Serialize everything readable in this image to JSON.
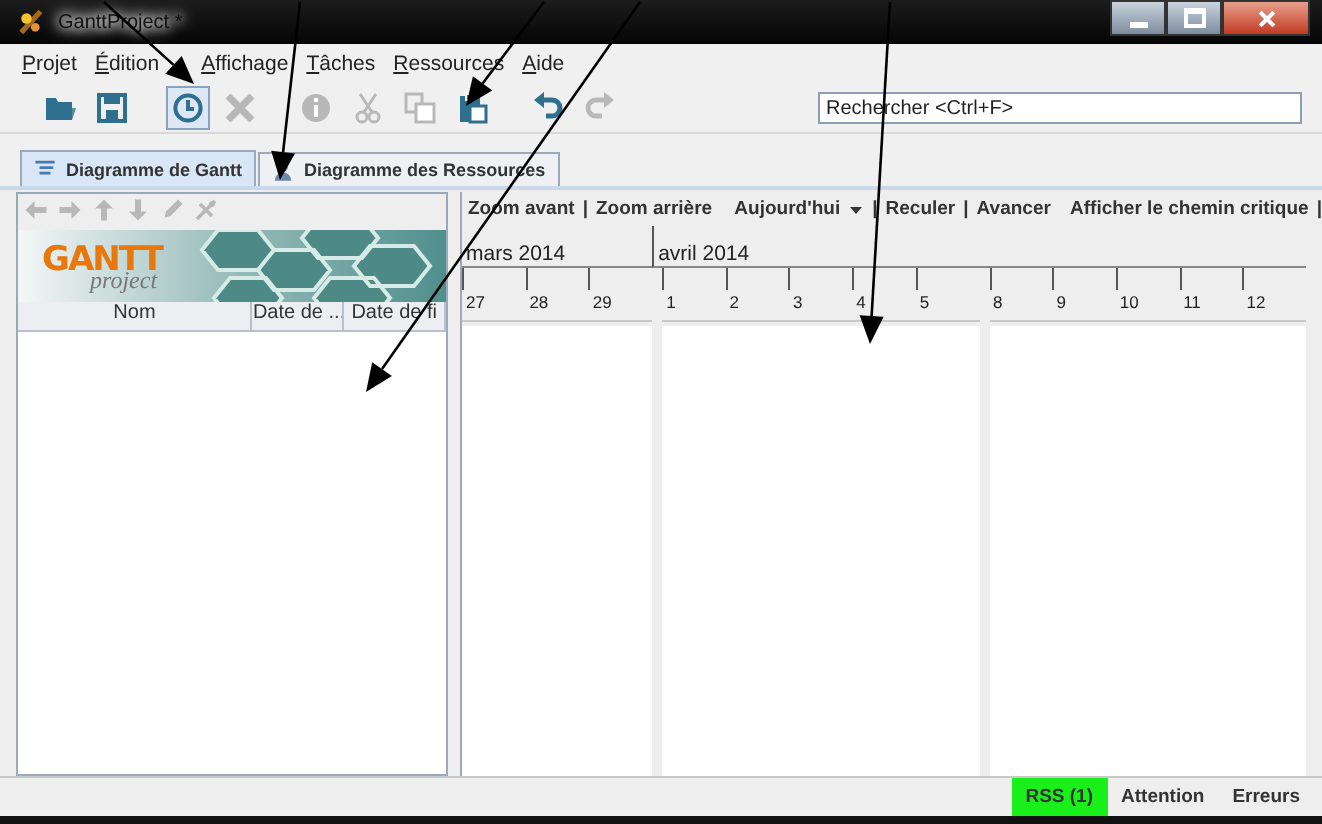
{
  "window": {
    "title": "GanttProject *"
  },
  "menu": [
    {
      "label": "Projet"
    },
    {
      "label": "Édition"
    },
    {
      "label": "Affichage"
    },
    {
      "label": "Tâches"
    },
    {
      "label": "Ressources"
    },
    {
      "label": "Aide"
    }
  ],
  "toolbar": [
    [
      {
        "kind": "open",
        "disabled": false,
        "pressed": false
      },
      {
        "kind": "save",
        "disabled": false,
        "pressed": false
      }
    ],
    [
      {
        "kind": "clock",
        "disabled": false,
        "pressed": true
      },
      {
        "kind": "delete",
        "disabled": true,
        "pressed": false
      }
    ],
    [
      {
        "kind": "info",
        "disabled": true,
        "pressed": false
      },
      {
        "kind": "cut",
        "disabled": true,
        "pressed": false
      },
      {
        "kind": "copy",
        "disabled": true,
        "pressed": false
      },
      {
        "kind": "paste",
        "disabled": false,
        "pressed": false
      }
    ],
    [
      {
        "kind": "undo",
        "disabled": false,
        "pressed": false
      },
      {
        "kind": "redo",
        "disabled": true,
        "pressed": false
      }
    ]
  ],
  "search": {
    "placeholder": "Rechercher <Ctrl+F>"
  },
  "tabs": [
    {
      "label": "Diagramme de Gantt",
      "selected": true
    },
    {
      "label": "Diagramme des Ressources",
      "selected": false
    }
  ],
  "task_tree": {
    "nav_buttons": [
      {
        "kind": "left",
        "disabled": true
      },
      {
        "kind": "right",
        "disabled": true
      },
      {
        "kind": "up",
        "disabled": true
      },
      {
        "kind": "down",
        "disabled": true
      },
      {
        "kind": "edit",
        "disabled": true
      },
      {
        "kind": "unlink",
        "disabled": true
      }
    ],
    "logo": {
      "wordmark": "GANTT",
      "subtitle": "project"
    },
    "columns": [
      "Nom",
      "Date de ...",
      "Date de fi"
    ]
  },
  "chart": {
    "actions": [
      {
        "kind": "link",
        "label": "Zoom avant"
      },
      {
        "kind": "separator",
        "label": "|"
      },
      {
        "kind": "link",
        "label": "Zoom arrière"
      },
      {
        "kind": "space"
      },
      {
        "kind": "dropdown",
        "label": "Aujourd'hui"
      },
      {
        "kind": "separator",
        "label": "|"
      },
      {
        "kind": "link",
        "label": "Reculer"
      },
      {
        "kind": "separator",
        "label": "|"
      },
      {
        "kind": "link",
        "label": "Avancer"
      },
      {
        "kind": "gap"
      },
      {
        "kind": "link",
        "label": "Afficher le chemin critique"
      },
      {
        "kind": "separator",
        "label": "|"
      }
    ],
    "months": [
      {
        "label": "mars 2014",
        "weeks": [
          {
            "days": [
              "27",
              "28",
              "29"
            ]
          }
        ]
      },
      {
        "label": "avril 2014",
        "weeks": [
          {
            "days": [
              "1",
              "2",
              "3",
              "4",
              "5"
            ]
          },
          {
            "days": [
              "8",
              "9",
              "10",
              "11",
              "12"
            ]
          }
        ]
      }
    ]
  },
  "status_bar": [
    {
      "label": "RSS (1)",
      "highlighted": true
    },
    {
      "label": "Attention",
      "highlighted": false
    },
    {
      "label": "Erreurs",
      "highlighted": false
    }
  ]
}
